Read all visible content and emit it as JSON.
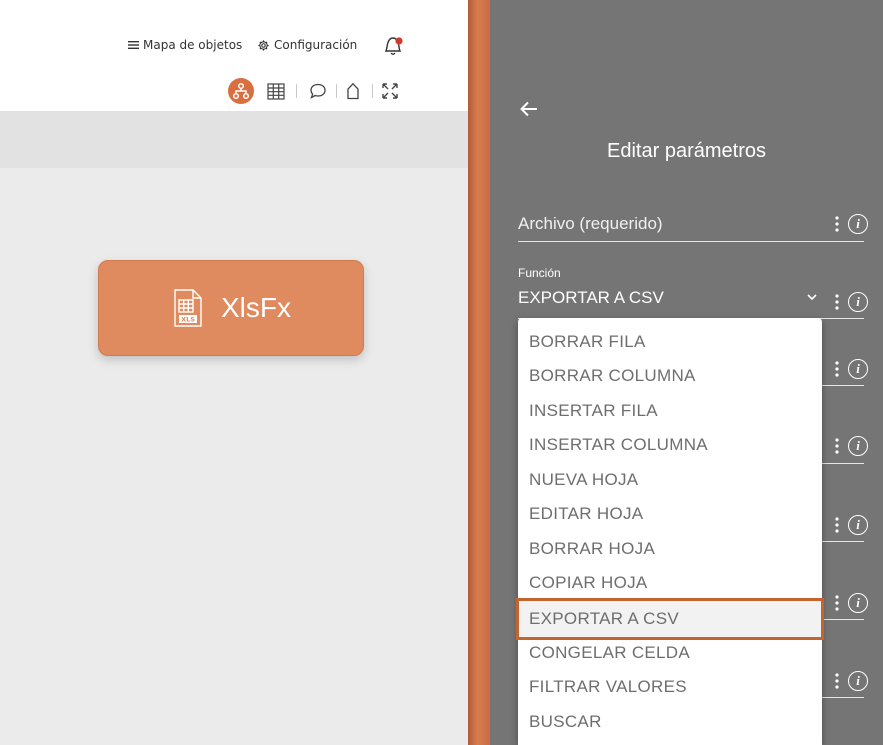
{
  "header": {
    "nav": [
      {
        "label": "Mapa de objetos",
        "icon": "hamburger-icon"
      },
      {
        "label": "Configuración",
        "icon": "gear-icon"
      }
    ],
    "notification_icon": "bell-icon",
    "toolbar_icons": [
      "flow-diagram-icon",
      "grid-icon",
      "chat-bubble-icon",
      "tag-icon",
      "fullscreen-icon"
    ]
  },
  "canvas": {
    "node": {
      "label": "XlsFx",
      "icon": "xls-file-icon",
      "color": "#e08a5f"
    }
  },
  "panel": {
    "title": "Editar parámetros",
    "back_icon": "arrow-left-icon",
    "fields": [
      {
        "placeholder": "Archivo (requerido)"
      },
      {
        "label": "Función",
        "value": "EXPORTAR A CSV"
      }
    ]
  },
  "dropdown": {
    "options": [
      "BORRAR FILA",
      "BORRAR COLUMNA",
      "INSERTAR FILA",
      "INSERTAR COLUMNA",
      "NUEVA HOJA",
      "EDITAR HOJA",
      "BORRAR HOJA",
      "COPIAR HOJA",
      "EXPORTAR A CSV",
      "CONGELAR CELDA",
      "FILTRAR VALORES",
      "BUSCAR"
    ],
    "selected": "EXPORTAR A CSV",
    "highlight_color": "#c4652f"
  },
  "colors": {
    "accent": "#d96f3f",
    "panel_bg": "#757575"
  }
}
